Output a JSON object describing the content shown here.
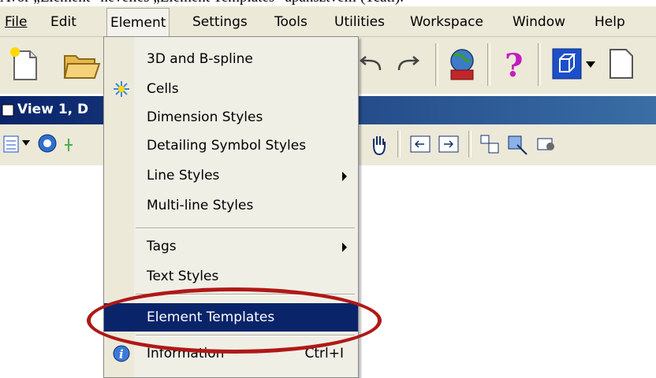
{
  "caption": "Avor „Element” névélies „Element Templates” apansztvelli (Tcati).",
  "menubar": {
    "items": [
      {
        "label": "File"
      },
      {
        "label": "Edit"
      },
      {
        "label": "Element"
      },
      {
        "label": "Settings"
      },
      {
        "label": "Tools"
      },
      {
        "label": "Utilities"
      },
      {
        "label": "Workspace"
      },
      {
        "label": "Window"
      },
      {
        "label": "Help"
      }
    ]
  },
  "window": {
    "title": "View 1, D"
  },
  "dropdown": {
    "items": [
      {
        "label": "3D and B-spline"
      },
      {
        "label": "Cells"
      },
      {
        "label": "Dimension Styles"
      },
      {
        "label": "Detailing Symbol Styles"
      },
      {
        "label": "Line Styles"
      },
      {
        "label": "Multi-line Styles"
      },
      {
        "label": "Tags"
      },
      {
        "label": "Text Styles"
      },
      {
        "label": "Element Templates"
      },
      {
        "label": "Information",
        "shortcut": "Ctrl+I"
      }
    ]
  },
  "colors": {
    "menu_bg": "#ece9d8",
    "selection": "#0a246a",
    "title_start": "#0a246a",
    "title_end": "#3a6ea5",
    "highlight_ellipse": "#b01818"
  },
  "icons": [
    "new-file-icon",
    "open-folder-icon",
    "undo-icon",
    "redo-icon",
    "globe-book-icon",
    "help-question-icon",
    "view-box-icon",
    "cells-icon",
    "info-icon",
    "window-icon",
    "hand-pan-icon"
  ]
}
